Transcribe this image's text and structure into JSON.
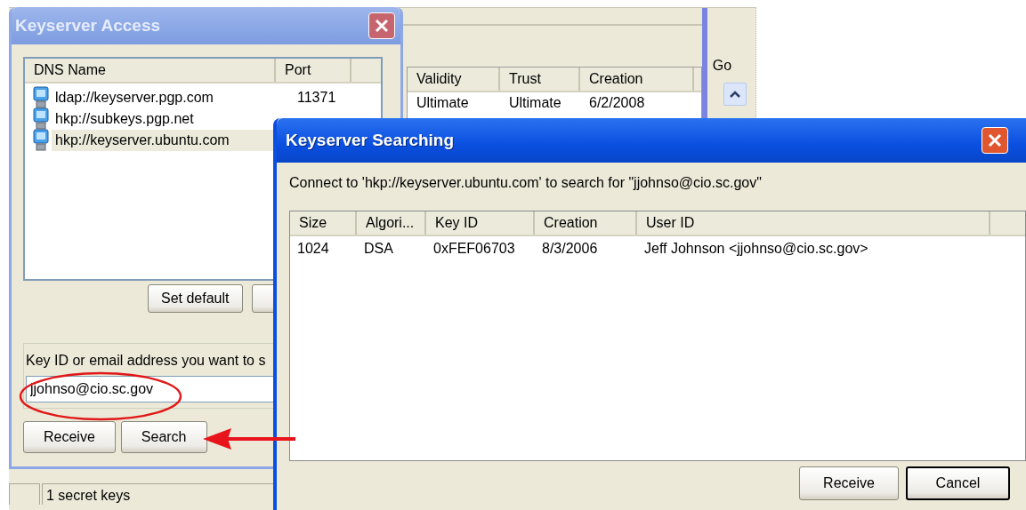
{
  "main_window": {
    "keys_table": {
      "columns": [
        "Validity",
        "Trust",
        "Creation"
      ],
      "rows": [
        [
          "Ultimate",
          "Ultimate",
          "6/2/2008"
        ]
      ]
    },
    "side_panel": {
      "label": "Go"
    },
    "status_bar": [
      "1 secret keys"
    ]
  },
  "keyserver_access": {
    "title": "Keyserver Access",
    "servers": {
      "columns": [
        "DNS Name",
        "Port"
      ],
      "rows": [
        {
          "dns_name": "ldap://keyserver.pgp.com",
          "port": "11371",
          "selected": false
        },
        {
          "dns_name": "hkp://subkeys.pgp.net",
          "selected": false
        },
        {
          "dns_name": "hkp://keyserver.ubuntu.com",
          "selected": true
        }
      ]
    },
    "list_buttons": [
      "Set default"
    ],
    "search_label": "Key ID or email address you want to s",
    "search_value": "jjohnso@cio.sc.gov",
    "buttons": [
      "Receive",
      "Search"
    ]
  },
  "keyserver_searching": {
    "title": "Keyserver Searching",
    "message": "Connect to 'hkp://keyserver.ubuntu.com' to search for \"jjohnso@cio.sc.gov\"",
    "results": {
      "columns": [
        "Size",
        "Algori...",
        "Key ID",
        "Creation",
        "User ID"
      ],
      "rows": [
        [
          "1024",
          "DSA",
          "0xFEF06703",
          "8/3/2006",
          "Jeff Johnson <jjohnso@cio.sc.gov>"
        ]
      ]
    },
    "buttons": [
      {
        "label": "Receive",
        "default": false
      },
      {
        "label": "Cancel",
        "default": true
      }
    ]
  }
}
